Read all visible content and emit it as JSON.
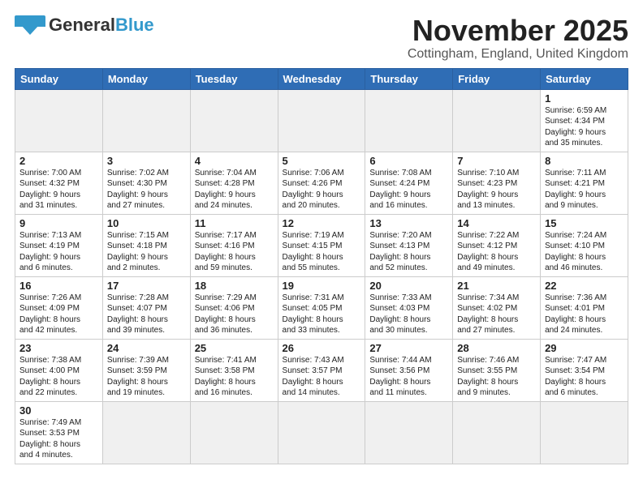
{
  "header": {
    "logo_general": "General",
    "logo_blue": "Blue",
    "title": "November 2025",
    "location": "Cottingham, England, United Kingdom"
  },
  "days_of_week": [
    "Sunday",
    "Monday",
    "Tuesday",
    "Wednesday",
    "Thursday",
    "Friday",
    "Saturday"
  ],
  "weeks": [
    [
      {
        "day": "",
        "info": "",
        "empty": true
      },
      {
        "day": "",
        "info": "",
        "empty": true
      },
      {
        "day": "",
        "info": "",
        "empty": true
      },
      {
        "day": "",
        "info": "",
        "empty": true
      },
      {
        "day": "",
        "info": "",
        "empty": true
      },
      {
        "day": "",
        "info": "",
        "empty": true
      },
      {
        "day": "1",
        "info": "Sunrise: 6:59 AM\nSunset: 4:34 PM\nDaylight: 9 hours\nand 35 minutes."
      }
    ],
    [
      {
        "day": "2",
        "info": "Sunrise: 7:00 AM\nSunset: 4:32 PM\nDaylight: 9 hours\nand 31 minutes."
      },
      {
        "day": "3",
        "info": "Sunrise: 7:02 AM\nSunset: 4:30 PM\nDaylight: 9 hours\nand 27 minutes."
      },
      {
        "day": "4",
        "info": "Sunrise: 7:04 AM\nSunset: 4:28 PM\nDaylight: 9 hours\nand 24 minutes."
      },
      {
        "day": "5",
        "info": "Sunrise: 7:06 AM\nSunset: 4:26 PM\nDaylight: 9 hours\nand 20 minutes."
      },
      {
        "day": "6",
        "info": "Sunrise: 7:08 AM\nSunset: 4:24 PM\nDaylight: 9 hours\nand 16 minutes."
      },
      {
        "day": "7",
        "info": "Sunrise: 7:10 AM\nSunset: 4:23 PM\nDaylight: 9 hours\nand 13 minutes."
      },
      {
        "day": "8",
        "info": "Sunrise: 7:11 AM\nSunset: 4:21 PM\nDaylight: 9 hours\nand 9 minutes."
      }
    ],
    [
      {
        "day": "9",
        "info": "Sunrise: 7:13 AM\nSunset: 4:19 PM\nDaylight: 9 hours\nand 6 minutes."
      },
      {
        "day": "10",
        "info": "Sunrise: 7:15 AM\nSunset: 4:18 PM\nDaylight: 9 hours\nand 2 minutes."
      },
      {
        "day": "11",
        "info": "Sunrise: 7:17 AM\nSunset: 4:16 PM\nDaylight: 8 hours\nand 59 minutes."
      },
      {
        "day": "12",
        "info": "Sunrise: 7:19 AM\nSunset: 4:15 PM\nDaylight: 8 hours\nand 55 minutes."
      },
      {
        "day": "13",
        "info": "Sunrise: 7:20 AM\nSunset: 4:13 PM\nDaylight: 8 hours\nand 52 minutes."
      },
      {
        "day": "14",
        "info": "Sunrise: 7:22 AM\nSunset: 4:12 PM\nDaylight: 8 hours\nand 49 minutes."
      },
      {
        "day": "15",
        "info": "Sunrise: 7:24 AM\nSunset: 4:10 PM\nDaylight: 8 hours\nand 46 minutes."
      }
    ],
    [
      {
        "day": "16",
        "info": "Sunrise: 7:26 AM\nSunset: 4:09 PM\nDaylight: 8 hours\nand 42 minutes."
      },
      {
        "day": "17",
        "info": "Sunrise: 7:28 AM\nSunset: 4:07 PM\nDaylight: 8 hours\nand 39 minutes."
      },
      {
        "day": "18",
        "info": "Sunrise: 7:29 AM\nSunset: 4:06 PM\nDaylight: 8 hours\nand 36 minutes."
      },
      {
        "day": "19",
        "info": "Sunrise: 7:31 AM\nSunset: 4:05 PM\nDaylight: 8 hours\nand 33 minutes."
      },
      {
        "day": "20",
        "info": "Sunrise: 7:33 AM\nSunset: 4:03 PM\nDaylight: 8 hours\nand 30 minutes."
      },
      {
        "day": "21",
        "info": "Sunrise: 7:34 AM\nSunset: 4:02 PM\nDaylight: 8 hours\nand 27 minutes."
      },
      {
        "day": "22",
        "info": "Sunrise: 7:36 AM\nSunset: 4:01 PM\nDaylight: 8 hours\nand 24 minutes."
      }
    ],
    [
      {
        "day": "23",
        "info": "Sunrise: 7:38 AM\nSunset: 4:00 PM\nDaylight: 8 hours\nand 22 minutes."
      },
      {
        "day": "24",
        "info": "Sunrise: 7:39 AM\nSunset: 3:59 PM\nDaylight: 8 hours\nand 19 minutes."
      },
      {
        "day": "25",
        "info": "Sunrise: 7:41 AM\nSunset: 3:58 PM\nDaylight: 8 hours\nand 16 minutes."
      },
      {
        "day": "26",
        "info": "Sunrise: 7:43 AM\nSunset: 3:57 PM\nDaylight: 8 hours\nand 14 minutes."
      },
      {
        "day": "27",
        "info": "Sunrise: 7:44 AM\nSunset: 3:56 PM\nDaylight: 8 hours\nand 11 minutes."
      },
      {
        "day": "28",
        "info": "Sunrise: 7:46 AM\nSunset: 3:55 PM\nDaylight: 8 hours\nand 9 minutes."
      },
      {
        "day": "29",
        "info": "Sunrise: 7:47 AM\nSunset: 3:54 PM\nDaylight: 8 hours\nand 6 minutes."
      }
    ],
    [
      {
        "day": "30",
        "info": "Sunrise: 7:49 AM\nSunset: 3:53 PM\nDaylight: 8 hours\nand 4 minutes."
      },
      {
        "day": "",
        "info": "",
        "empty": true
      },
      {
        "day": "",
        "info": "",
        "empty": true
      },
      {
        "day": "",
        "info": "",
        "empty": true
      },
      {
        "day": "",
        "info": "",
        "empty": true
      },
      {
        "day": "",
        "info": "",
        "empty": true
      },
      {
        "day": "",
        "info": "",
        "empty": true
      }
    ]
  ]
}
